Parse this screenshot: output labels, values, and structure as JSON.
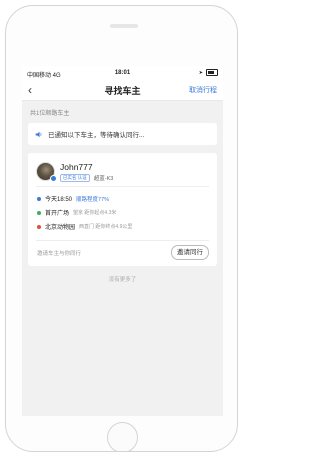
{
  "status_bar": {
    "carrier": "中国移动 4G",
    "time": "18:01"
  },
  "nav": {
    "title": "寻找车主",
    "cancel_label": "取消行程"
  },
  "section_label": "共1位顺路车主",
  "notice": {
    "text": "已通知以下车主，等待确认同行..."
  },
  "driver": {
    "name": "John777",
    "badge": "已实名 认证",
    "plate": "超蓝-K3"
  },
  "route": {
    "time_label": "今天18:50",
    "match_label": "顺路程度77%",
    "origin_main": "首开广场",
    "origin_sub": "望京 距你起点4.3米",
    "dest_main": "北京动物园",
    "dest_sub": "西直门 距你终点4.9公里"
  },
  "invite_hint": "邀请车主与你同行",
  "invite_button": "邀请同行",
  "no_more": "没有更多了",
  "colors": {
    "accent": "#3b7ad9",
    "time_dot": "#3b7ad9",
    "origin_dot": "#3fae5a",
    "dest_dot": "#e0513a"
  },
  "icons": {
    "back": "chevron-left-icon",
    "notice": "speaker-icon",
    "battery": "battery-icon"
  }
}
